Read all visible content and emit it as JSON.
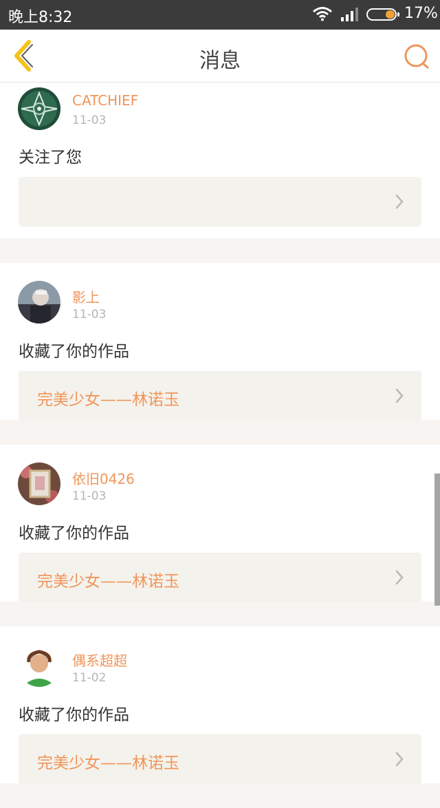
{
  "status_bar": {
    "time": "晚上8:32",
    "battery": "17%"
  },
  "header": {
    "title": "消息"
  },
  "messages": [
    {
      "name": "CATCHIEF",
      "date": "11-03",
      "action": "关注了您",
      "work": ""
    },
    {
      "name": "影上",
      "date": "11-03",
      "action": "收藏了你的作品",
      "work": "完美少女——林诺玉"
    },
    {
      "name": "依旧0426",
      "date": "11-03",
      "action": "收藏了你的作品",
      "work": "完美少女——林诺玉"
    },
    {
      "name": "偶系超超",
      "date": "11-02",
      "action": "收藏了你的作品",
      "work": "完美少女——林诺玉"
    }
  ],
  "colors": {
    "accent": "#f0955a",
    "back_arrow": "#f5c21a",
    "page_bg": "#f7f4f2",
    "work_bg": "#f4f2ec"
  }
}
